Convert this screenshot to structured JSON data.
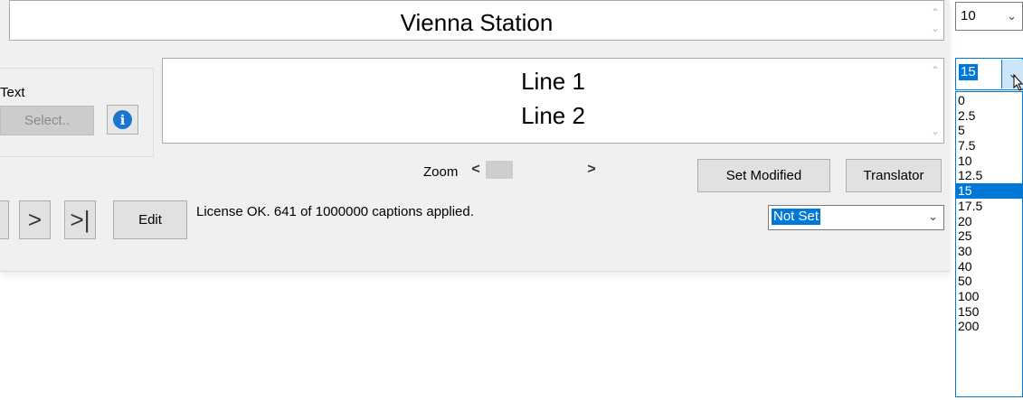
{
  "title_box": {
    "text": "Vienna Station"
  },
  "font_size_combo": {
    "value": "10"
  },
  "text_group": {
    "label": "Text",
    "select_button": "Select..",
    "info_icon_glyph": "i"
  },
  "caption": {
    "line1": "Line 1",
    "line2": "Line 2"
  },
  "zoom": {
    "label": "Zoom",
    "left_arrow": "<",
    "right_arrow": ">"
  },
  "buttons": {
    "set_modified": "Set Modified",
    "translator": "Translator",
    "edit": "Edit"
  },
  "nav": {
    "next": ">",
    "last": ">|"
  },
  "status_text": "License OK. 641 of 1000000 captions applied.",
  "modified_combo": {
    "value": "Not Set"
  },
  "size_combo": {
    "value": "15",
    "options": [
      "0",
      "2.5",
      "5",
      "7.5",
      "10",
      "12.5",
      "15",
      "17.5",
      "20",
      "25",
      "30",
      "40",
      "50",
      "100",
      "150",
      "200"
    ],
    "selected_option": "15"
  },
  "colors": {
    "accent": "#0078d7",
    "info_icon": "#1976d2",
    "panel": "#f0f0f0"
  },
  "icons": [
    "scroll-up-icon",
    "scroll-down-icon",
    "info-icon",
    "chevron-down-icon",
    "next-icon",
    "last-icon",
    "mouse-cursor-icon"
  ]
}
